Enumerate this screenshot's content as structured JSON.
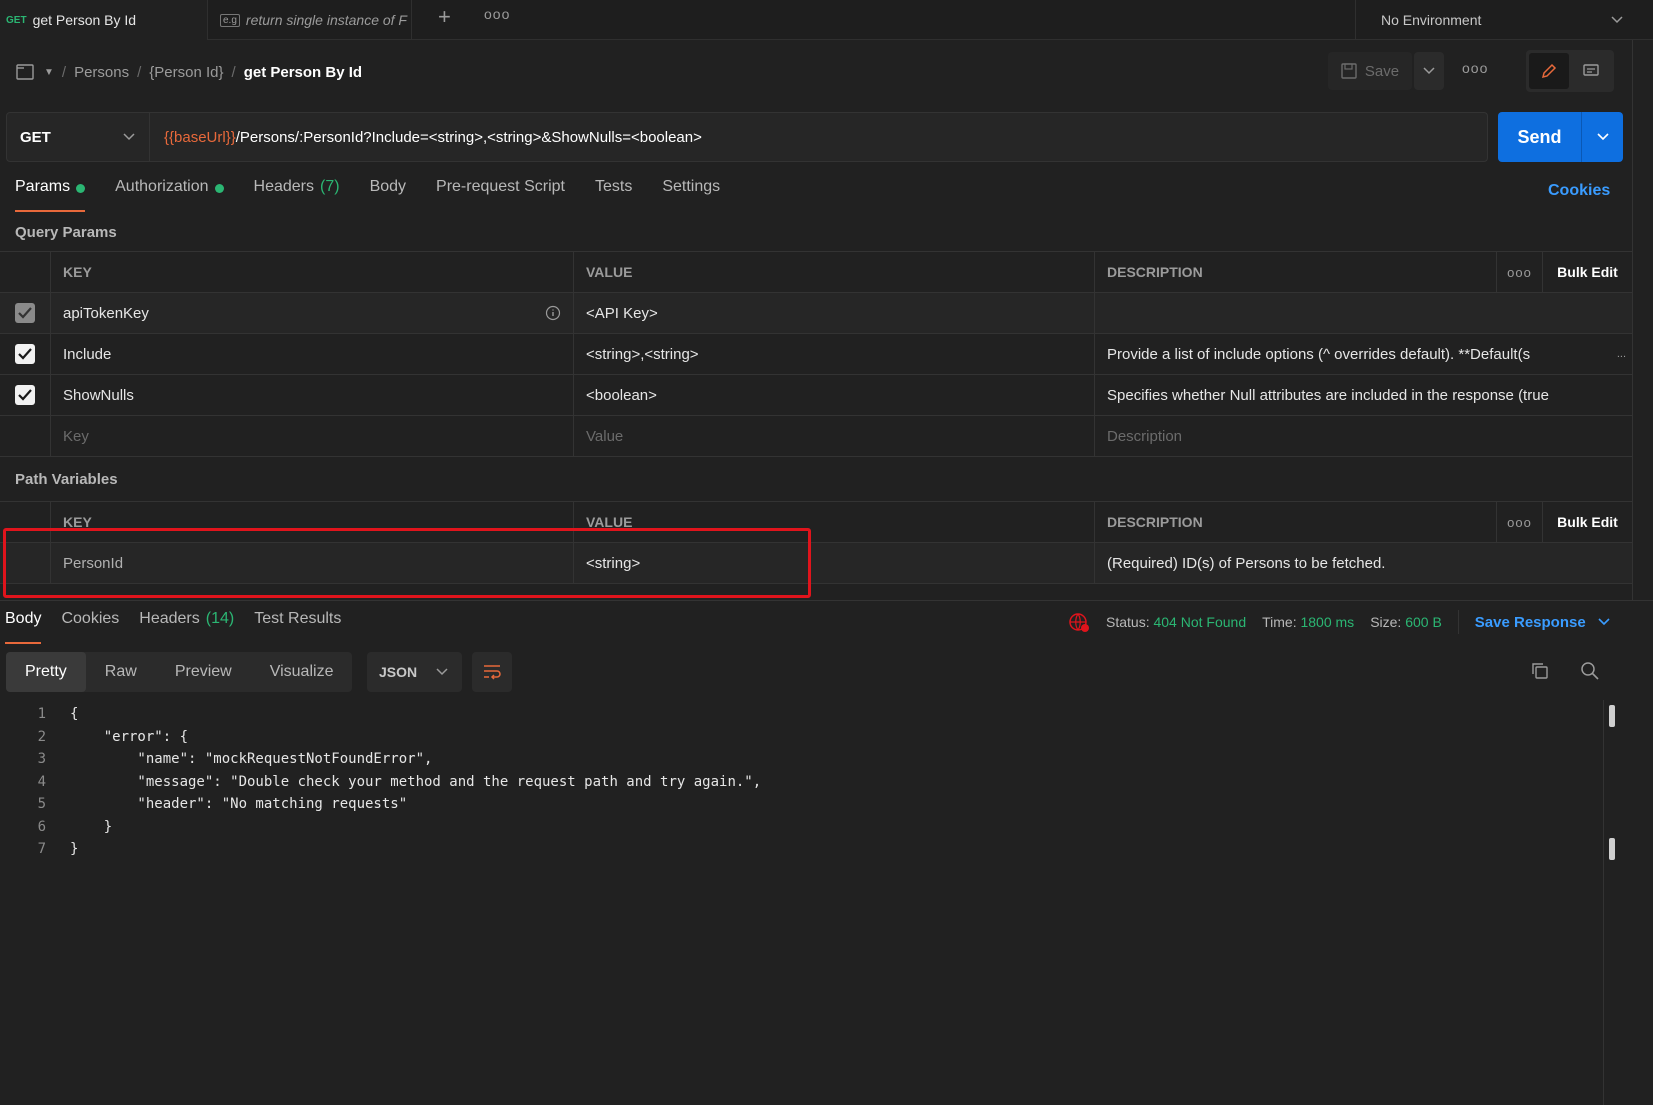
{
  "tabs": [
    {
      "method": "GET",
      "title": "get Person By Id"
    },
    {
      "title": "return single instance of F"
    }
  ],
  "environment": "No Environment",
  "breadcrumb": {
    "items": [
      "Persons",
      "{Person Id}"
    ],
    "current": "get Person By Id"
  },
  "save_label": "Save",
  "request": {
    "method": "GET",
    "url_var": "{{baseUrl}}",
    "url_rest": "/Persons/:PersonId?Include=<string>,<string>&ShowNulls=<boolean>",
    "send_label": "Send"
  },
  "req_tabs": {
    "params": "Params",
    "authorization": "Authorization",
    "headers": "Headers",
    "headers_count": "(7)",
    "body": "Body",
    "prescript": "Pre-request Script",
    "tests": "Tests",
    "settings": "Settings",
    "cookies": "Cookies"
  },
  "query": {
    "title": "Query Params",
    "headers": {
      "key": "KEY",
      "value": "VALUE",
      "description": "DESCRIPTION",
      "bulk": "Bulk Edit"
    },
    "rows": [
      {
        "key": "apiTokenKey",
        "value": "<API Key>",
        "description": "",
        "checked": true
      },
      {
        "key": "Include",
        "value": "<string>,<string>",
        "description": "Provide a list of include options (^ overrides default).  **Default(s",
        "checked": true
      },
      {
        "key": "ShowNulls",
        "value": "<boolean>",
        "description": "Specifies whether Null attributes are included in the response (true",
        "checked": true
      }
    ],
    "placeholders": {
      "key": "Key",
      "value": "Value",
      "description": "Description"
    }
  },
  "path": {
    "title": "Path Variables",
    "headers": {
      "key": "KEY",
      "value": "VALUE",
      "description": "DESCRIPTION",
      "bulk": "Bulk Edit"
    },
    "rows": [
      {
        "key": "PersonId",
        "value": "<string>",
        "description": "(Required) ID(s) of Persons to be fetched."
      }
    ]
  },
  "response": {
    "tabs": {
      "body": "Body",
      "cookies": "Cookies",
      "headers": "Headers",
      "headers_count": "(14)",
      "tests": "Test Results"
    },
    "status_label": "Status:",
    "status": "404 Not Found",
    "time_label": "Time:",
    "time": "1800 ms",
    "size_label": "Size:",
    "size": "600 B",
    "save_label": "Save Response",
    "formats": [
      "Pretty",
      "Raw",
      "Preview",
      "Visualize"
    ],
    "lang": "JSON"
  },
  "code_lines": [
    "{",
    "    \"error\": {",
    "        \"name\": \"mockRequestNotFoundError\",",
    "        \"message\": \"Double check your method and the request path and try again.\",",
    "        \"header\": \"No matching requests\"",
    "    }",
    "}"
  ],
  "colors": {
    "accent": "#0e6fe0",
    "success": "#2bb673",
    "variable": "#e8693b",
    "highlight": "#e0141c"
  }
}
